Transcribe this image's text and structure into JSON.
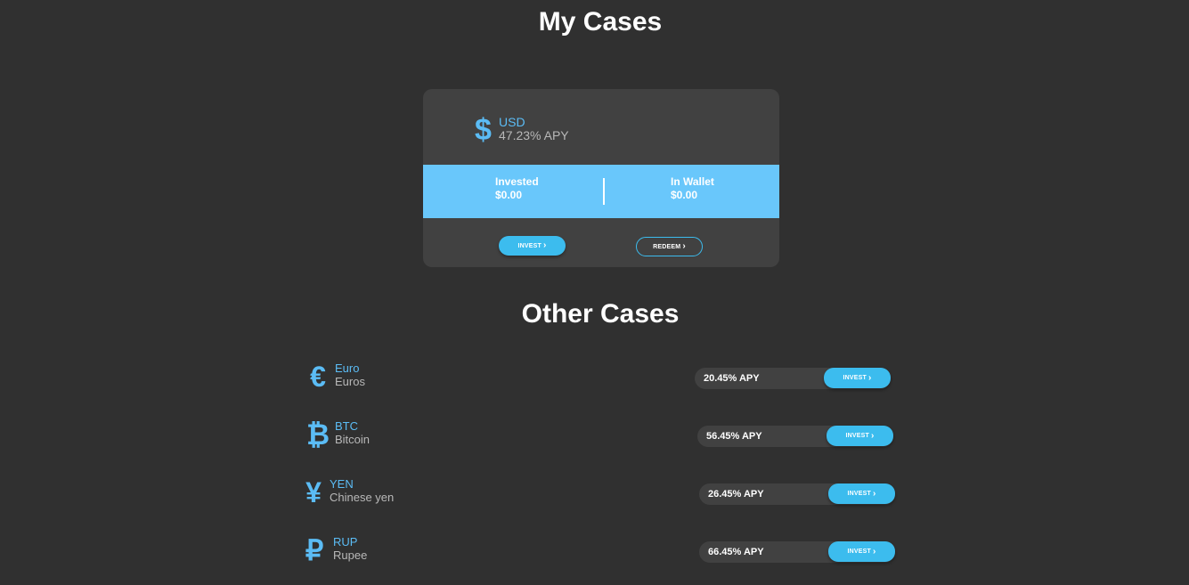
{
  "header": {
    "title": "My Cases"
  },
  "my_case": {
    "symbol": "$",
    "code": "USD",
    "apy": "47.23% APY",
    "invested_label": "Invested",
    "invested_value": "$0.00",
    "wallet_label": "In Wallet",
    "wallet_value": "$0.00",
    "invest_label": "INVEST",
    "redeem_label": "REDEEM"
  },
  "other_section": {
    "title": "Other Cases"
  },
  "other_cases": [
    {
      "symbol": "€",
      "code": "Euro",
      "name": "Euros",
      "apy": "20.45% APY",
      "invest_label": "INVEST"
    },
    {
      "symbol": "₿",
      "code": "BTC",
      "name": "Bitcoin",
      "apy": "56.45% APY",
      "invest_label": "INVEST"
    },
    {
      "symbol": "¥",
      "code": "YEN",
      "name": "Chinese yen",
      "apy": "26.45% APY",
      "invest_label": "INVEST"
    },
    {
      "symbol": "₽",
      "code": "RUP",
      "name": "Rupee",
      "apy": "66.45% APY",
      "invest_label": "INVEST"
    }
  ],
  "icons": {
    "chevron": "chevron-right-icon"
  },
  "colors": {
    "background": "#303030",
    "card": "#414141",
    "band": "#69c7fb",
    "accent": "#3cbcee",
    "link": "#5bbcf5"
  }
}
